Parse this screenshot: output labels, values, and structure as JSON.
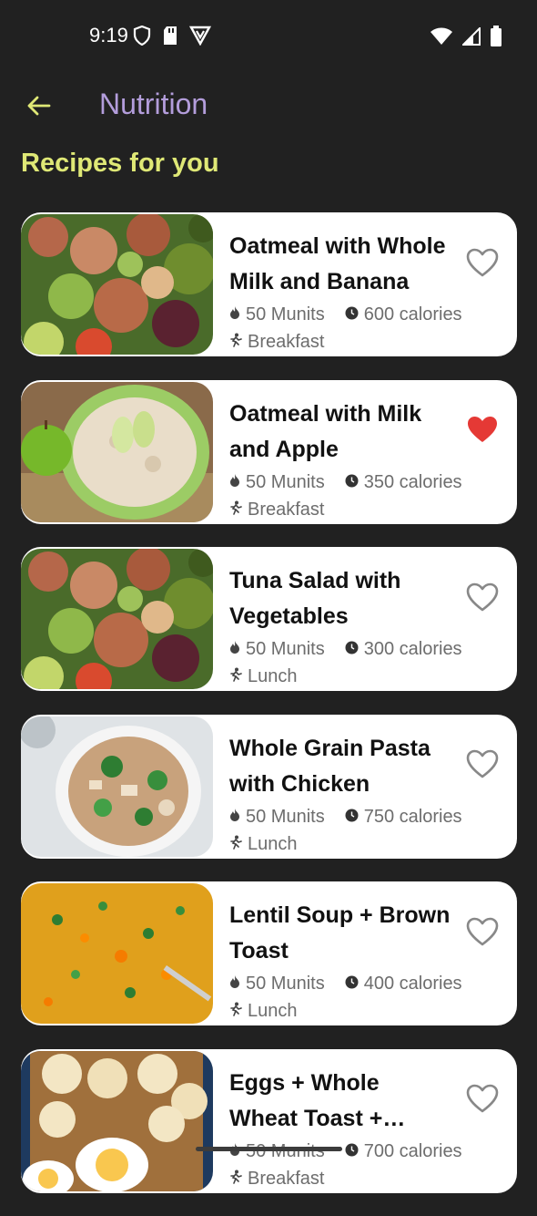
{
  "status_bar": {
    "time": "9:19"
  },
  "header": {
    "title": "Nutrition"
  },
  "section": {
    "title": "Recipes for you"
  },
  "recipes": [
    {
      "title": "Oatmeal with Whole Milk and Banana",
      "duration": "50 Munits",
      "calories": "600 calories",
      "meal": "Breakfast",
      "favorite": false,
      "image": "salad"
    },
    {
      "title": "Oatmeal with Milk and Apple",
      "duration": "50 Munits",
      "calories": "350 calories",
      "meal": "Breakfast",
      "favorite": true,
      "image": "oatmeal"
    },
    {
      "title": "Tuna Salad with Vegetables",
      "duration": "50 Munits",
      "calories": "300 calories",
      "meal": "Lunch",
      "favorite": false,
      "image": "salad"
    },
    {
      "title": "Whole Grain Pasta with Chicken",
      "duration": "50 Munits",
      "calories": "750 calories",
      "meal": "Lunch",
      "favorite": false,
      "image": "pasta"
    },
    {
      "title": "Lentil Soup + Brown Toast",
      "duration": "50 Munits",
      "calories": "400 calories",
      "meal": "Lunch",
      "favorite": false,
      "image": "soup"
    },
    {
      "title": "Eggs + Whole Wheat Toast + Peanut Butter",
      "duration": "50 Munits",
      "calories": "700 calories",
      "meal": "Breakfast",
      "favorite": false,
      "image": "toast"
    }
  ],
  "colors": {
    "background": "#212121",
    "title": "#b39ddb",
    "section": "#dfe876",
    "favorite": "#e53935",
    "card": "#ffffff"
  }
}
